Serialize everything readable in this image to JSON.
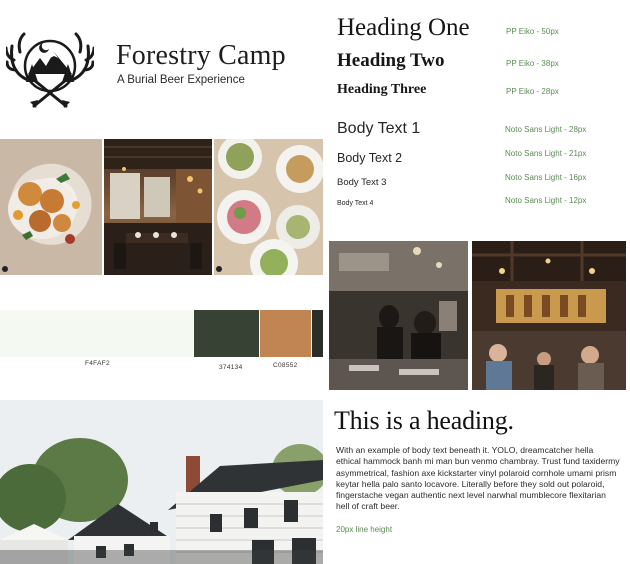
{
  "brand": {
    "title": "Forestry Camp",
    "subtitle": "A Burial Beer Experience"
  },
  "type_scale": {
    "headings": [
      {
        "label": "Heading One",
        "spec": "PP Eiko - 50px"
      },
      {
        "label": "Heading Two",
        "spec": "PP Eiko - 38px"
      },
      {
        "label": "Heading Three",
        "spec": "PP Eiko - 28px"
      }
    ],
    "body": [
      {
        "label": "Body Text 1",
        "spec": "Noto Sans Light - 28px"
      },
      {
        "label": "Body Text 2",
        "spec": "Noto Sans Light - 21px"
      },
      {
        "label": "Body Text 3",
        "spec": "Noto Sans Light - 16px"
      },
      {
        "label": "Body Text 4",
        "spec": "Noto Sans Light - 12px"
      }
    ]
  },
  "palette": [
    {
      "hex": "#F4FAF2",
      "label": "F4FAF2"
    },
    {
      "hex": "#374134",
      "label": "374134"
    },
    {
      "hex": "#C08552",
      "label": "C08552"
    },
    {
      "hex": "#2A2F2A",
      "label": ""
    }
  ],
  "sample": {
    "heading": "This is a heading.",
    "paragraph": "With an example of body text beneath it. YOLO, dreamcatcher hella ethical hammock banh mi man bun venmo chambray. Trust fund taxidermy asymmetrical, fashion axe kickstarter vinyl polaroid cornhole umami prism keytar hella palo santo locavore. Literally before they sold out polaroid, fingerstache vegan authentic next level narwhal mumblecore flexitarian hell of craft beer.",
    "note": "20px line height"
  },
  "colors": {
    "spec_green": "#5C8A55",
    "text": "#1F1F1F"
  }
}
